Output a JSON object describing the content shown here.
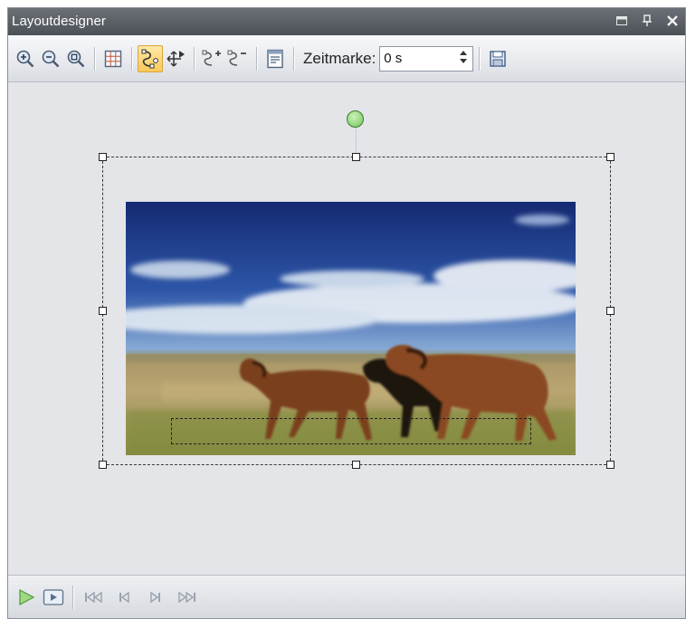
{
  "window": {
    "title": "Layoutdesigner",
    "controls": [
      "window-position-icon",
      "pin-icon",
      "close-icon"
    ]
  },
  "toolbar": {
    "buttons": [
      {
        "name": "zoom-in-icon"
      },
      {
        "name": "zoom-out-icon"
      },
      {
        "name": "zoom-fit-icon"
      },
      {
        "name": "grid-icon"
      },
      {
        "name": "motion-path-icon",
        "active": true
      },
      {
        "name": "move-anchor-icon"
      },
      {
        "name": "add-keyframe-icon"
      },
      {
        "name": "remove-keyframe-icon"
      },
      {
        "name": "properties-icon"
      }
    ],
    "timestamp_label": "Zeitmarke:",
    "timestamp_value": "0 s",
    "save_icon": "save-icon"
  },
  "playback": {
    "buttons": [
      "play-icon",
      "preview-icon",
      "first-keyframe-icon",
      "previous-keyframe-icon",
      "next-keyframe-icon",
      "last-keyframe-icon"
    ]
  },
  "colors": {
    "titlebar": "#5a5e65",
    "canvas": "#e3e5e8",
    "active_button": "#f8c95a",
    "rotation_handle": "#72c45c"
  }
}
